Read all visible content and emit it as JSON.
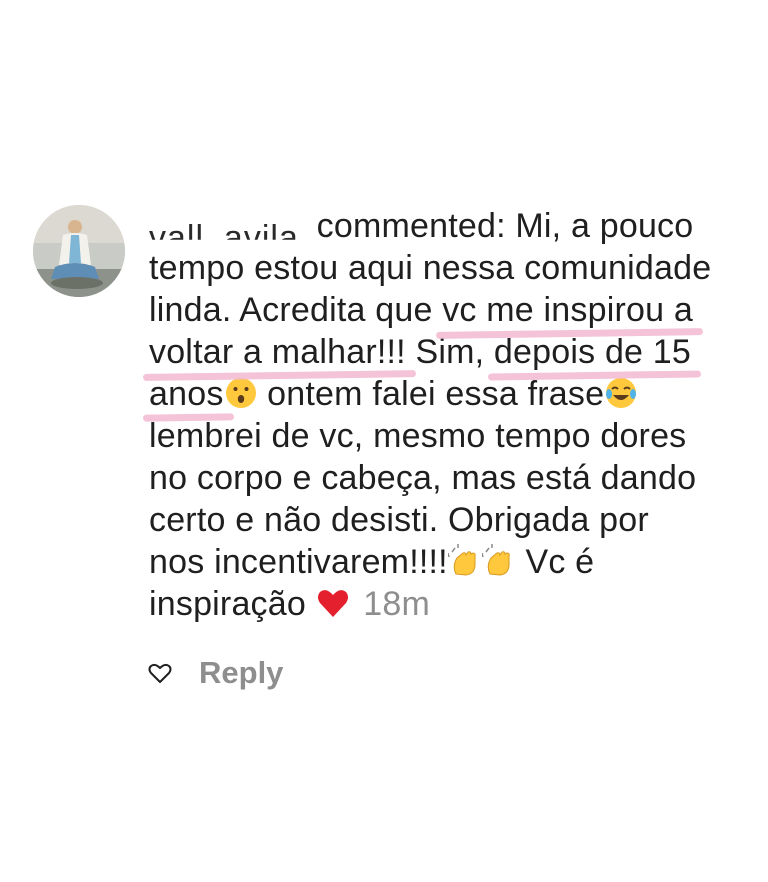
{
  "comment": {
    "username": "vall_avila",
    "verb": "commented:",
    "lines": [
      "Mi, a pouco",
      "tempo estou aqui nessa comunidade",
      "linda. Acredita que ",
      "vc me inspirou a",
      "voltar a malhar!!!",
      " Sim, ",
      "depois de 15",
      "anos",
      " ontem falei essa frase",
      "lembrei de vc, mesmo tempo dores",
      "no corpo e cabeça, mas está dando",
      "certo e não desisti. Obrigada por",
      "nos incentivarem!!!!",
      " Vc é",
      "inspiração "
    ],
    "timestamp": "18m",
    "emojis": {
      "surprised": "surprised-face-emoji",
      "laughing": "tears-of-joy-emoji",
      "clap": "clapping-hands-emoji",
      "heart": "red-heart-emoji"
    }
  },
  "actions": {
    "reply_label": "Reply",
    "like_icon": "heart-outline-icon"
  },
  "colors": {
    "text": "#1f1f1f",
    "muted": "#8e8e8e",
    "highlight": "#f2b9d0"
  }
}
